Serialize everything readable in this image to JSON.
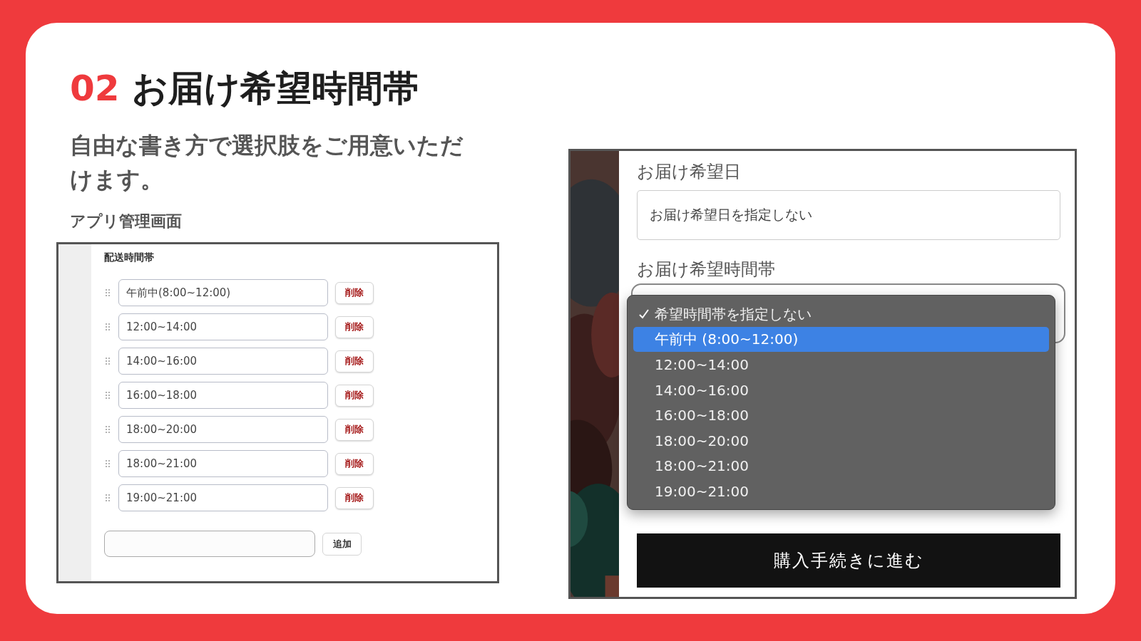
{
  "slide": {
    "number": "02",
    "title": "お届け希望時間帯",
    "lead": "自由な書き方で選択肢をご用意いただけます。",
    "caption": "アプリ管理画面"
  },
  "admin": {
    "section_title": "配送時間帯",
    "rows": [
      {
        "value": "午前中(8:00~12:00)",
        "delete": "削除"
      },
      {
        "value": "12:00~14:00",
        "delete": "削除"
      },
      {
        "value": "14:00~16:00",
        "delete": "削除"
      },
      {
        "value": "16:00~18:00",
        "delete": "削除"
      },
      {
        "value": "18:00~20:00",
        "delete": "削除"
      },
      {
        "value": "18:00~21:00",
        "delete": "削除"
      },
      {
        "value": "19:00~21:00",
        "delete": "削除"
      }
    ],
    "add_button": "追加"
  },
  "storefront": {
    "date_label": "お届け希望日",
    "date_field": {
      "value": "お届け希望日を指定しない"
    },
    "time_label": "お届け希望時間帯",
    "time_menu": {
      "expanded": true,
      "options": [
        {
          "label": "希望時間帯を指定しない",
          "checked": true,
          "highlighted": false
        },
        {
          "label": "午前中 (8:00~12:00)",
          "checked": false,
          "highlighted": true
        },
        {
          "label": "12:00~14:00",
          "checked": false,
          "highlighted": false
        },
        {
          "label": "14:00~16:00",
          "checked": false,
          "highlighted": false
        },
        {
          "label": "16:00~18:00",
          "checked": false,
          "highlighted": false
        },
        {
          "label": "18:00~20:00",
          "checked": false,
          "highlighted": false
        },
        {
          "label": "18:00~21:00",
          "checked": false,
          "highlighted": false
        },
        {
          "label": "19:00~21:00",
          "checked": false,
          "highlighted": false
        }
      ]
    },
    "checkout_button": "購入手続きに進む"
  }
}
